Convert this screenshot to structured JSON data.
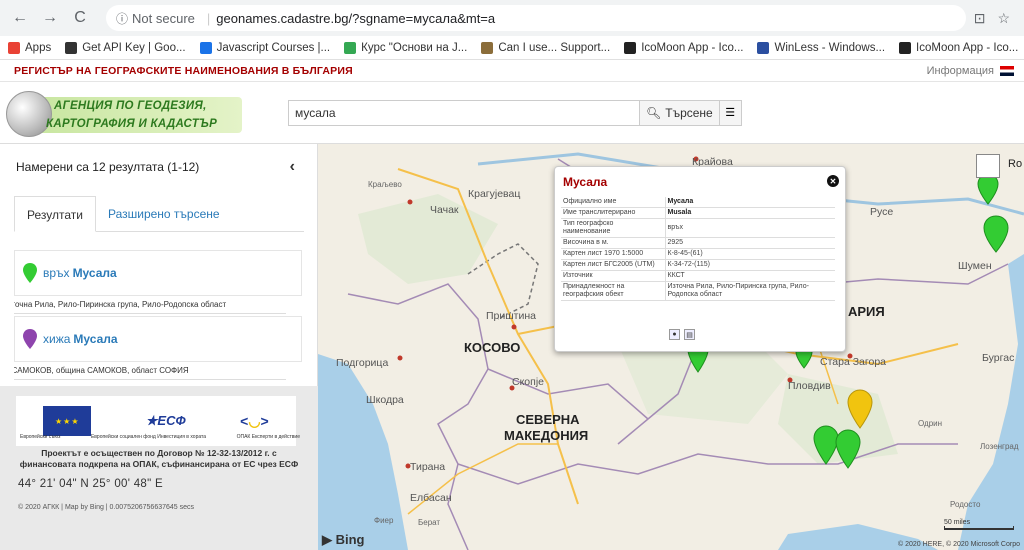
{
  "browser": {
    "not_secure": "Not secure",
    "url": "geonames.cadastre.bg/?sgname=мусала&mt=a"
  },
  "bookmarks": [
    {
      "label": "Apps",
      "color": "#e94235"
    },
    {
      "label": "Get API Key | Goo...",
      "color": "#333333"
    },
    {
      "label": "Javascript Courses |...",
      "color": "#1a73e8"
    },
    {
      "label": "Курс \"Основи на J...",
      "color": "#34a853"
    },
    {
      "label": "Can I use... Support...",
      "color": "#8b6d3a"
    },
    {
      "label": "IcoMoon App - Ico...",
      "color": "#222222"
    },
    {
      "label": "WinLess - Windows...",
      "color": "#2b4fa0"
    },
    {
      "label": "IcoMoon App - Ico...",
      "color": "#222222"
    }
  ],
  "site": {
    "registry_title": "РЕГИСТЪР НА ГЕОГРАФСКИТЕ НАИМЕНОВАНИЯ В БЪЛГАРИЯ",
    "info_link": "Информация",
    "logo_line1": "АГЕНЦИЯ ПО ГЕОДЕЗИЯ,",
    "logo_line2": "КАРТОГРАФИЯ И КАДАСТЪР",
    "search_value": "мусала",
    "search_button": "Търсене"
  },
  "sidebar": {
    "results_count": "Намерени са 12 резултата (1-12)",
    "tab_results": "Резултати",
    "tab_advanced": "Разширено търсене",
    "results": [
      {
        "type": "връх",
        "name": "Мусала",
        "pin_color": "#33cc33",
        "location": "Източна Рила, Рило-Пиринска група, Рило-Родопска област"
      },
      {
        "type": "хижа",
        "name": "Мусала",
        "pin_color": "#8e44ad",
        "location": "гр.САМОКОВ, община САМОКОВ, област СОФИЯ"
      }
    ],
    "eu_cap1": "Европейски съюз",
    "eu_cap2": "Европейски социален фонд Инвестиция в хората",
    "eu_cap3": "ОПАК Експерти в действие",
    "esf_label": "ЕСФ",
    "project_text_1": "Проектът е осъществен по Договор № 12-32-13/2012 г. с",
    "project_text_2": "финансовата подкрепа на ОПАК, съфинансирана от ЕС чрез ЕСФ",
    "coords": "44° 21' 04\" N 25° 00' 48\" E",
    "copyright": "© 2020 АГКК | Map by Bing | 0.0075206756637645 secs"
  },
  "map": {
    "labels": {
      "kraljevo": "Краљево",
      "kragujevac": "Крагујевац",
      "chachak": "Чачак",
      "krayova": "Крайова",
      "ruse": "Русе",
      "shumen": "Шумен",
      "bulgaria": "АРИЯ",
      "burgas": "Бургас",
      "stara_zagora": "Стара Загора",
      "plovdiv": "Пловдив",
      "podgorica": "Подгорица",
      "shkodra": "Шкодра",
      "pristina": "Приштина",
      "kosovo": "КОСОВО",
      "skopje": "Скопје",
      "north_macedonia_1": "СЕВЕРНА",
      "north_macedonia_2": "МАКЕДОНИЯ",
      "tirana": "Тирана",
      "elbasan": "Елбасан",
      "fier": "Фиер",
      "berat": "Берат",
      "odrin": "Одрин",
      "lozengrad": "Лозенград",
      "rodosto": "Родосто",
      "ro": "Ro"
    },
    "scale_label": "50 miles",
    "bing": "Bing",
    "copyright": "© 2020 HERE, © 2020 Microsoft Corpo"
  },
  "popup": {
    "title": "Мусала",
    "rows": [
      {
        "k": "Официално име",
        "v": "Мусала",
        "bold": true
      },
      {
        "k": "Име транслитерирано",
        "v": "Musala",
        "bold": true
      },
      {
        "k": "Тип географско наименование",
        "v": "връх",
        "bold": false
      },
      {
        "k": "Височина в м.",
        "v": "2925",
        "bold": false
      },
      {
        "k": "Картен лист 1970 1:5000",
        "v": "К-8-45-(61)",
        "bold": false
      },
      {
        "k": "Картен лист БГС2005 (UTM)",
        "v": "К-34-72-(115)",
        "bold": false
      },
      {
        "k": "Източник",
        "v": "ККСТ",
        "bold": false
      },
      {
        "k": "Принадлежност на географския обект",
        "v": "Източна Рила, Рило-Пиринска група, Рило-Родопска област",
        "bold": false
      }
    ]
  }
}
